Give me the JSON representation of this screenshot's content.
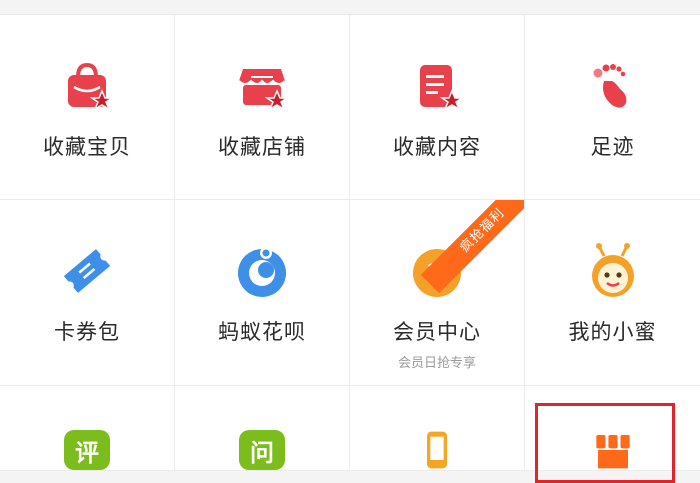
{
  "items": [
    {
      "label": "收藏宝贝",
      "icon": "favorite-bag-icon"
    },
    {
      "label": "收藏店铺",
      "icon": "favorite-shop-icon"
    },
    {
      "label": "收藏内容",
      "icon": "favorite-content-icon"
    },
    {
      "label": "足迹",
      "icon": "footprint-icon"
    },
    {
      "label": "卡券包",
      "icon": "coupon-icon"
    },
    {
      "label": "蚂蚁花呗",
      "icon": "huabei-icon"
    },
    {
      "label": "会员中心",
      "sub": "会员日抢专享",
      "icon": "vip-icon",
      "ribbon": "疯抢福利"
    },
    {
      "label": "我的小蜜",
      "icon": "bee-assistant-icon"
    }
  ],
  "row3": [
    {
      "glyph": "评",
      "icon": "review-icon",
      "color": "#7cbd1e"
    },
    {
      "glyph": "问",
      "icon": "ask-icon",
      "color": "#7cbd1e"
    },
    {
      "icon": "phone-icon",
      "color": "#f5a623"
    },
    {
      "icon": "store-icon",
      "color": "#ff6a1a"
    }
  ],
  "colors": {
    "red": "#e8414b",
    "orange": "#ff6a1a",
    "blue": "#3d8fe8",
    "highlight": "#e3232c"
  }
}
